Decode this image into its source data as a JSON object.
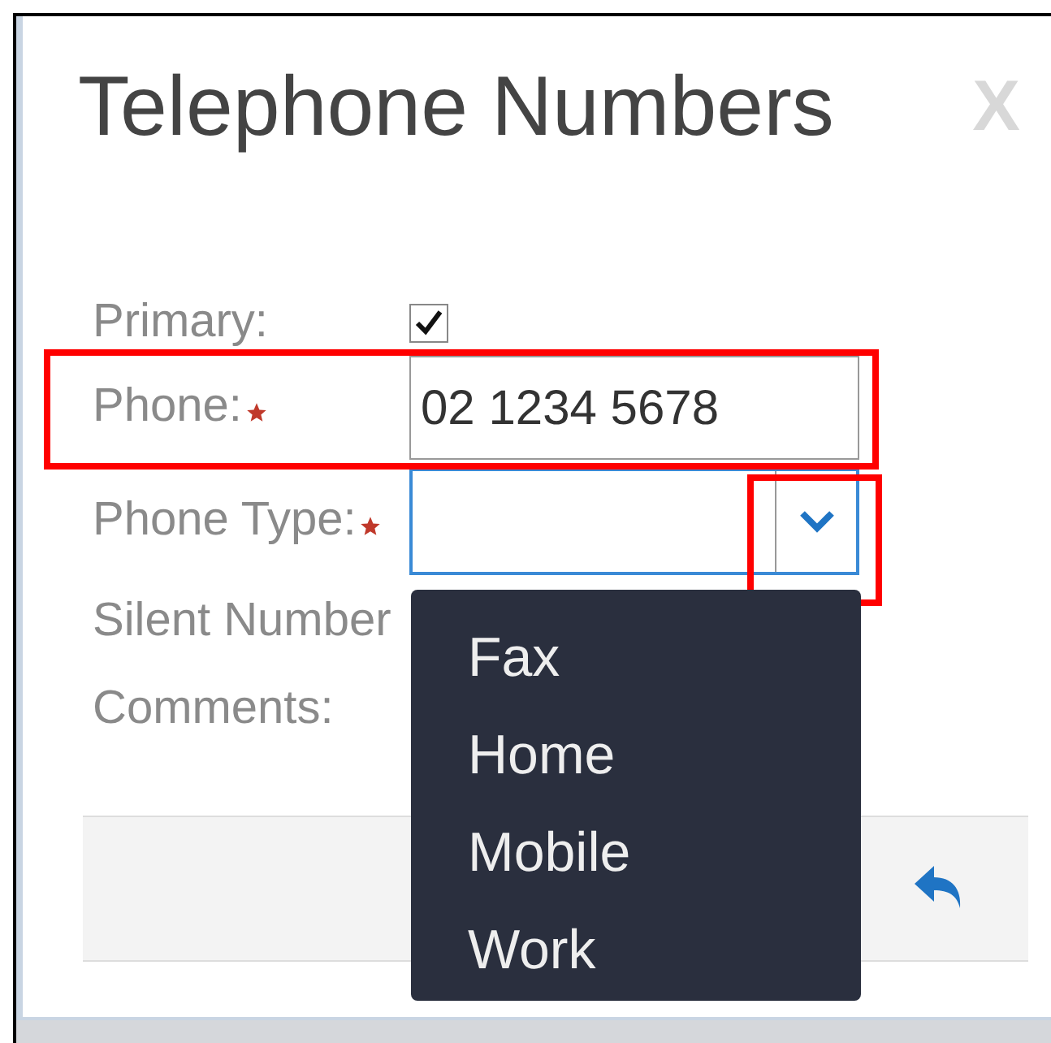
{
  "dialog": {
    "title": "Telephone Numbers",
    "close": "X"
  },
  "fields": [
    {
      "kind": "checkbox",
      "label": "Primary:",
      "required": false,
      "checked": true
    },
    {
      "kind": "text",
      "label": "Phone:",
      "required": true,
      "value": "02 1234 5678",
      "highlighted": true
    },
    {
      "kind": "select",
      "label": "Phone Type:",
      "required": true,
      "focused": true,
      "button_highlighted": true
    },
    {
      "kind": "plain",
      "label": "Silent Number",
      "required": false
    },
    {
      "kind": "plain",
      "label": "Comments:",
      "required": false
    }
  ],
  "dropdown": {
    "options": [
      {
        "label": "Fax"
      },
      {
        "label": "Home"
      },
      {
        "label": "Mobile"
      },
      {
        "label": "Work"
      }
    ]
  }
}
